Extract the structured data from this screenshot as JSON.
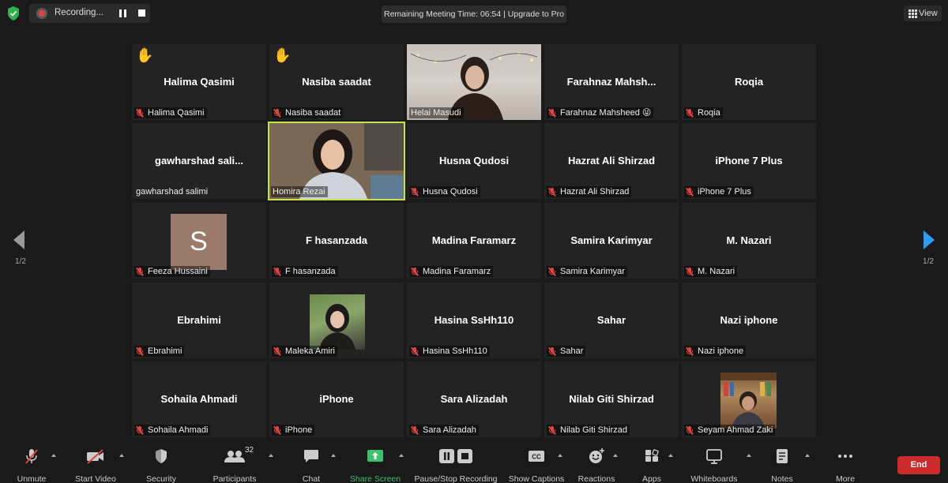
{
  "recording": {
    "label": "Recording..."
  },
  "meeting_timer": {
    "text": "Remaining Meeting Time: 06:54 | Upgrade to Pro"
  },
  "view_button": {
    "label": "View"
  },
  "pagination": {
    "left": "1/2",
    "right": "1/2"
  },
  "tiles": [
    {
      "center_name": "Halima Qasimi",
      "label": "Halima Qasimi",
      "muted": true,
      "hand_raised": true
    },
    {
      "center_name": "Nasiba saadat",
      "label": "Nasiba saadat",
      "muted": true,
      "hand_raised": true
    },
    {
      "center_name": "",
      "label": "Helai Masudi",
      "muted": false,
      "video": true
    },
    {
      "center_name": "Farahnaz  Mahsh...",
      "label": "Farahnaz Mahsheed",
      "muted": true,
      "label_emoji": "😜"
    },
    {
      "center_name": "Roqia",
      "label": "Roqia",
      "muted": true
    },
    {
      "center_name": "gawharshad  sali...",
      "label": "gawharshad salimi",
      "muted": false
    },
    {
      "center_name": "",
      "label": "Homira Rezai",
      "muted": false,
      "video": true,
      "active_speaker": true
    },
    {
      "center_name": "Husna Qudosi",
      "label": "Husna Qudosi",
      "muted": true
    },
    {
      "center_name": "Hazrat Ali Shirzad",
      "label": "Hazrat Ali Shirzad",
      "muted": true
    },
    {
      "center_name": "iPhone 7 Plus",
      "label": "iPhone 7 Plus",
      "muted": true
    },
    {
      "center_name": "",
      "label": "Feeza Hussaini",
      "muted": true,
      "avatar_letter": "S"
    },
    {
      "center_name": "F hasanzada",
      "label": "F hasanzada",
      "muted": true
    },
    {
      "center_name": "Madina Faramarz",
      "label": "Madina Faramarz",
      "muted": true
    },
    {
      "center_name": "Samira Karimyar",
      "label": "Samira Karimyar",
      "muted": true
    },
    {
      "center_name": "M. Nazari",
      "label": "M. Nazari",
      "muted": true
    },
    {
      "center_name": "Ebrahimi",
      "label": "Ebrahimi",
      "muted": true
    },
    {
      "center_name": "",
      "label": "Maleka Amiri",
      "muted": true,
      "thumbnail": true
    },
    {
      "center_name": "Hasina SsHh110",
      "label": "Hasina SsHh110",
      "muted": true
    },
    {
      "center_name": "Sahar",
      "label": "Sahar",
      "muted": true
    },
    {
      "center_name": "Nazi iphone",
      "label": "Nazi iphone",
      "muted": true
    },
    {
      "center_name": "Sohaila Ahmadi",
      "label": "Sohaila Ahmadi",
      "muted": true
    },
    {
      "center_name": "iPhone",
      "label": "iPhone",
      "muted": true
    },
    {
      "center_name": "Sara Alizadah",
      "label": "Sara Alizadah",
      "muted": true
    },
    {
      "center_name": "Nilab Giti Shirzad",
      "label": "Nilab Giti Shirzad",
      "muted": true
    },
    {
      "center_name": "",
      "label": "Seyam Ahmad Zaki",
      "muted": true,
      "thumbnail": true
    }
  ],
  "toolbar": {
    "unmute": "Unmute",
    "start_video": "Start Video",
    "security": "Security",
    "participants": "Participants",
    "participant_count": "32",
    "chat": "Chat",
    "share_screen": "Share Screen",
    "pause_stop_recording": "Pause/Stop Recording",
    "show_captions": "Show Captions",
    "reactions": "Reactions",
    "apps": "Apps",
    "whiteboards": "Whiteboards",
    "notes": "Notes",
    "more": "More",
    "end": "End"
  },
  "colors": {
    "background": "#1a1a1a",
    "tile": "#232323",
    "active_speaker_border": "#c8e04a",
    "muted_red": "#e0443e",
    "share_green": "#3fc06a",
    "end_red": "#cc2b2b",
    "nav_blue": "#2a9ff0"
  }
}
